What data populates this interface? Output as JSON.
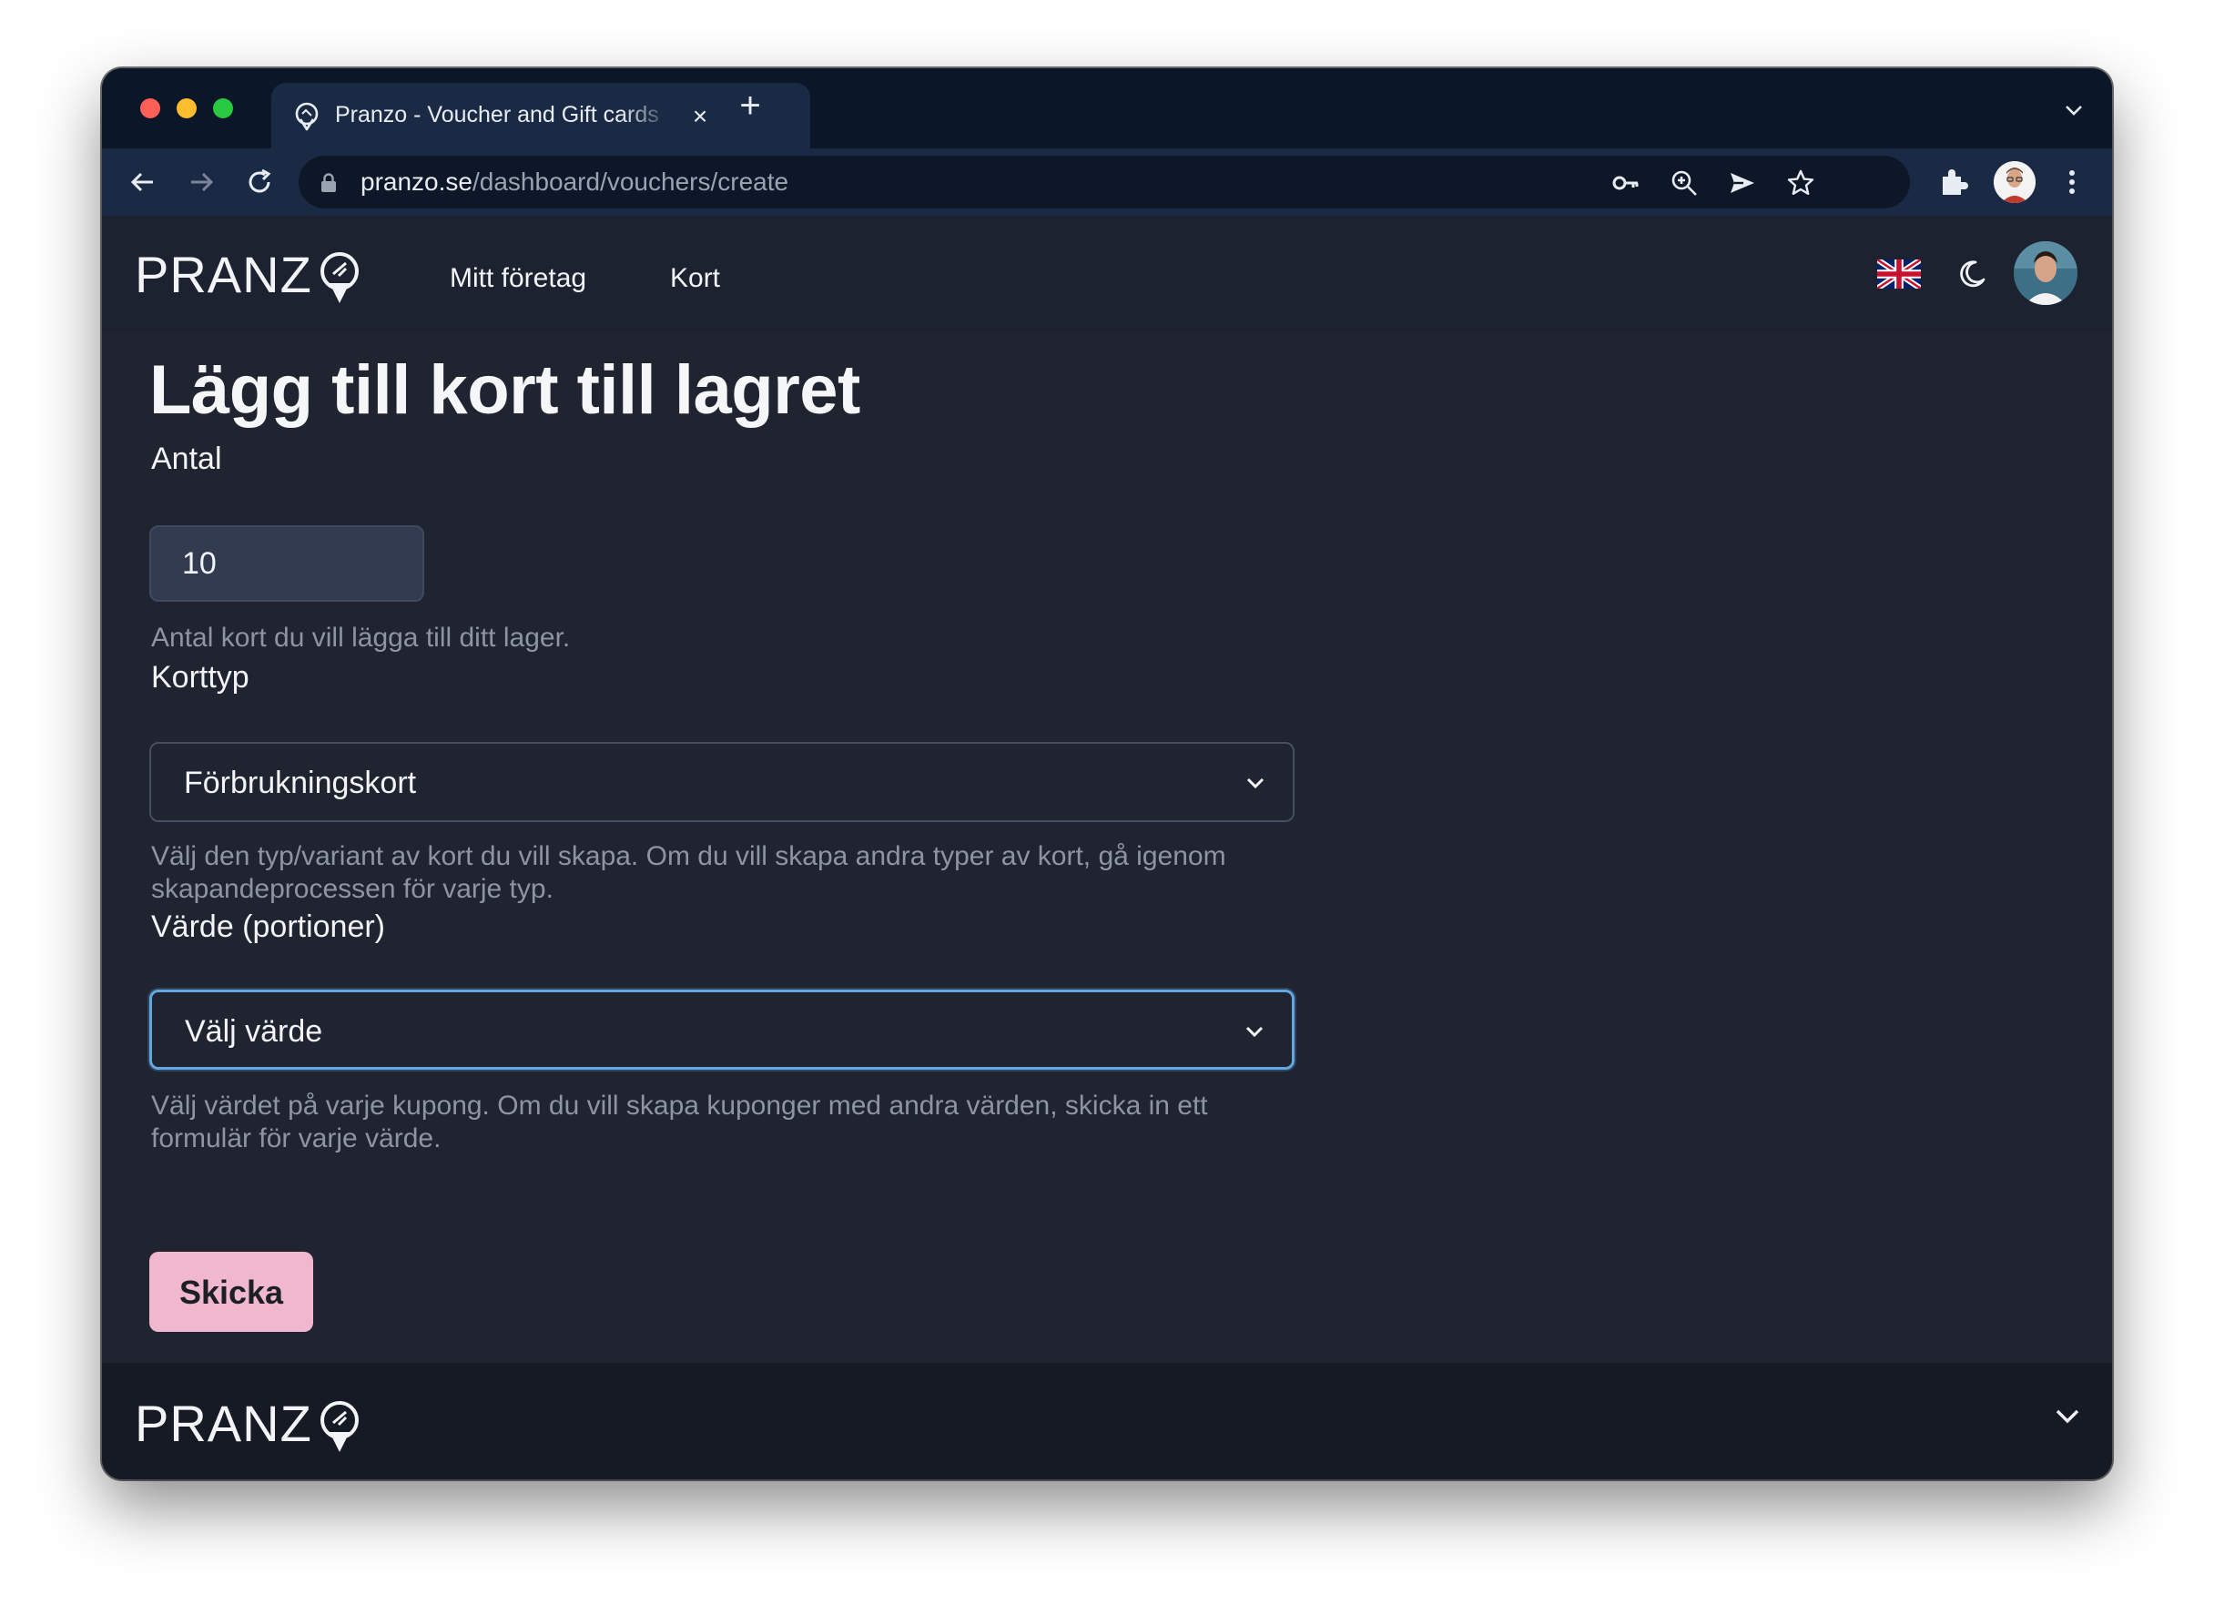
{
  "browser": {
    "tab_title": "Pranzo - Voucher and Gift cards",
    "tab_close": "×",
    "new_tab": "+",
    "url_host": "pranzo.se",
    "url_path": "/dashboard/vouchers/create",
    "icons": [
      "back-icon",
      "forward-icon",
      "reload-icon",
      "lock-icon",
      "key-icon",
      "zoom-icon",
      "send-icon",
      "star-icon",
      "extensions-icon",
      "profile-icon",
      "more-icon"
    ]
  },
  "header": {
    "logo_text": "PRANZ",
    "nav": [
      "Mitt företag",
      "Kort"
    ],
    "language_flag": "uk-flag-icon",
    "theme_icon": "moon-icon"
  },
  "form": {
    "title": "Lägg till kort till lagret",
    "quantity_label": "Antal",
    "quantity_value": "10",
    "quantity_help": "Antal kort du vill lägga till ditt lager.",
    "type_label": "Korttyp",
    "type_value": "Förbrukningskort",
    "type_help": "Välj den typ/variant av kort du vill skapa. Om du vill skapa andra typer av kort, gå igenom skapandeprocessen för varje typ.",
    "value_label": "Värde (portioner)",
    "value_placeholder": "Välj värde",
    "value_help": "Välj värdet på varje kupong. Om du vill skapa kuponger med andra värden, skicka in ett formulär för varje värde.",
    "submit": "Skicka"
  },
  "footer": {
    "logo_text": "PRANZ"
  },
  "colors": {
    "background": "#1f2430",
    "submit": "#f0b7cf",
    "focus_ring": "#62a7df",
    "help_text": "#8d94a3"
  }
}
